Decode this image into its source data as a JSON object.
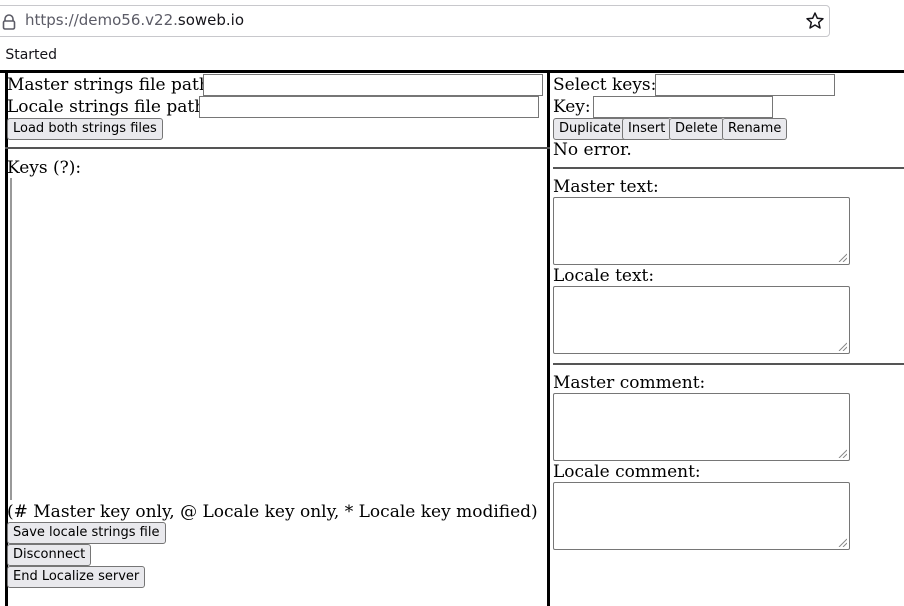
{
  "browser": {
    "url_prefix": "https://demo56.v22.",
    "url_host": "soweb.io",
    "bookmark_label": "g Started"
  },
  "left": {
    "master_path_label": "Master strings file path:",
    "master_path_value": "",
    "locale_path_label": "Locale strings file path:",
    "locale_path_value": "",
    "load_button": "Load both strings files",
    "keys_label": "Keys (?):",
    "legend": "(# Master key only, @ Locale key only, * Locale key modified)",
    "save_button": "Save locale strings file",
    "disconnect_button": "Disconnect",
    "end_button": "End Localize server"
  },
  "right": {
    "select_keys_label": "Select keys:",
    "select_keys_value": "",
    "key_label": "Key:",
    "key_value": "",
    "duplicate_button": "Duplicate",
    "insert_button": "Insert",
    "delete_button": "Delete",
    "rename_button": "Rename",
    "status_text": "No error.",
    "master_text_label": "Master text:",
    "locale_text_label": "Locale text:",
    "master_comment_label": "Master comment:",
    "locale_comment_label": "Locale comment:"
  }
}
